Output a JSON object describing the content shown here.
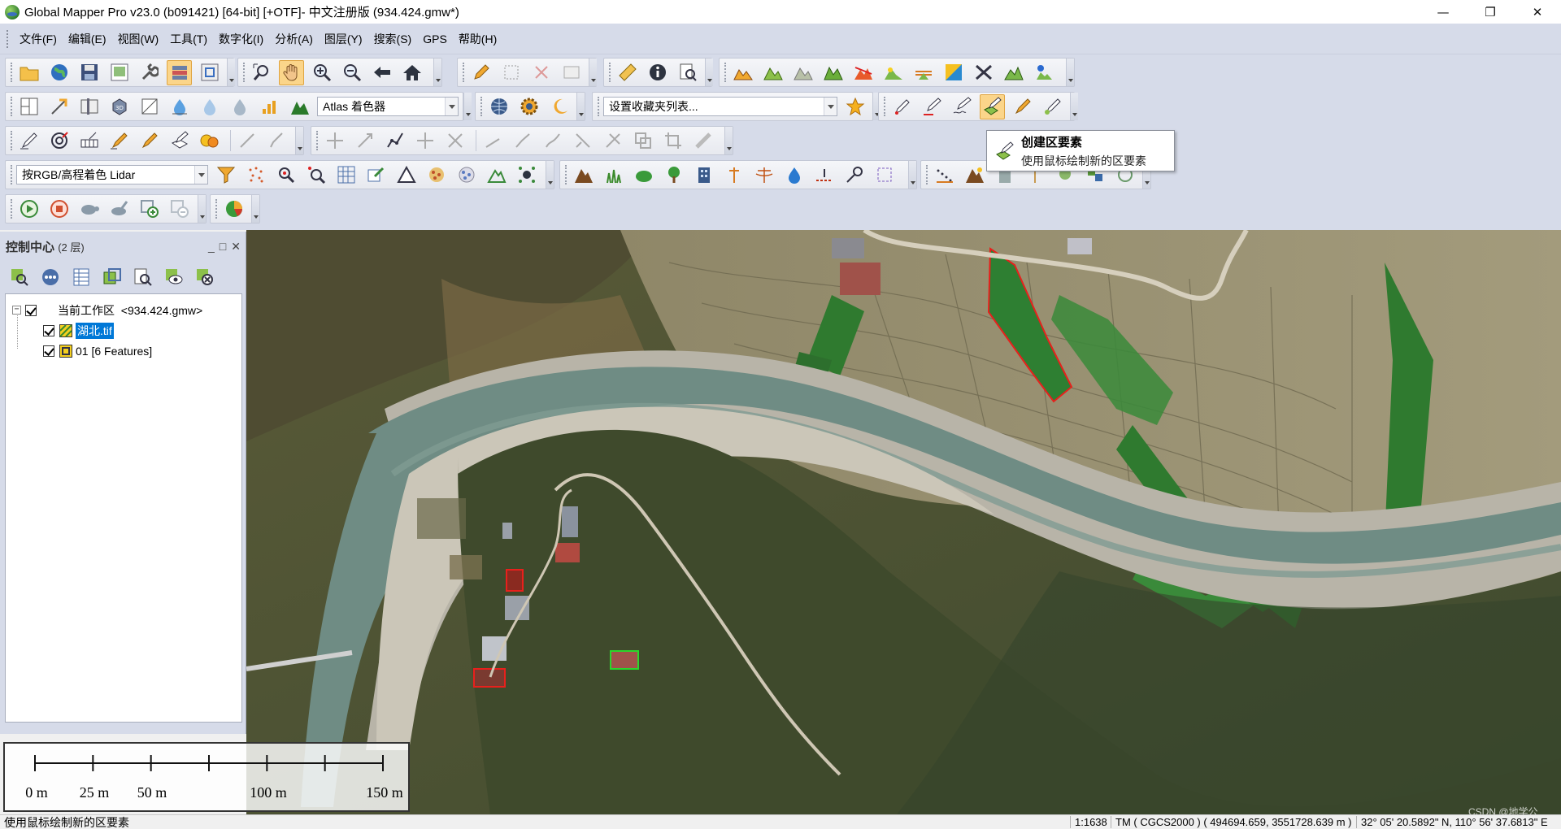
{
  "window": {
    "title": "Global Mapper Pro v23.0 (b091421) [64-bit] [+OTF]- 中文注册版 (934.424.gmw*)",
    "minimize": "—",
    "restore": "❐",
    "close": "✕"
  },
  "menu": [
    "文件(F)",
    "编辑(E)",
    "视图(W)",
    "工具(T)",
    "数字化(I)",
    "分析(A)",
    "图层(Y)",
    "搜索(S)",
    "GPS",
    "帮助(H)"
  ],
  "toolbar": {
    "shader_select": "Atlas 着色器",
    "favorites_select": "设置收藏夹列表...",
    "lidar_color_select": "按RGB/高程着色 Lidar"
  },
  "tooltip": {
    "title": "创建区要素",
    "description": "使用鼠标绘制新的区要素"
  },
  "control_center": {
    "title": "控制中心",
    "layer_count": "(2 层)",
    "pin": "_",
    "float": "□",
    "close": "✕",
    "workspace_label": "当前工作区",
    "workspace_file": "<934.424.gmw>",
    "collapse_symbol": "−",
    "layers": [
      {
        "name": "湖北.tif",
        "checked": true,
        "selected": true,
        "icon": "raster-layer-icon"
      },
      {
        "name": "01 [6 Features]",
        "checked": true,
        "selected": false,
        "icon": "vector-layer-icon"
      }
    ]
  },
  "scale_bar": {
    "labels": [
      "0 m",
      "25 m",
      "50 m",
      "100 m",
      "150 m"
    ],
    "ticks": [
      0,
      25,
      50,
      75,
      100,
      125,
      150
    ]
  },
  "status": {
    "message": "使用鼠标绘制新的区要素",
    "scale": "1:1638",
    "crs": "TM ( CGCS2000 ) ( 494694.659, 3551728.639 m )",
    "coordinates": "32° 05' 20.5892\" N, 110° 56' 37.6813\" E",
    "watermark": "CSDN @地学公"
  },
  "colors": {
    "toolbar_bg": "#d6dbe9",
    "active_tool": "#fbd58a",
    "selection": "#0078d7",
    "polygon_red": "#e8201c",
    "polygon_green": "#2bd62b"
  }
}
